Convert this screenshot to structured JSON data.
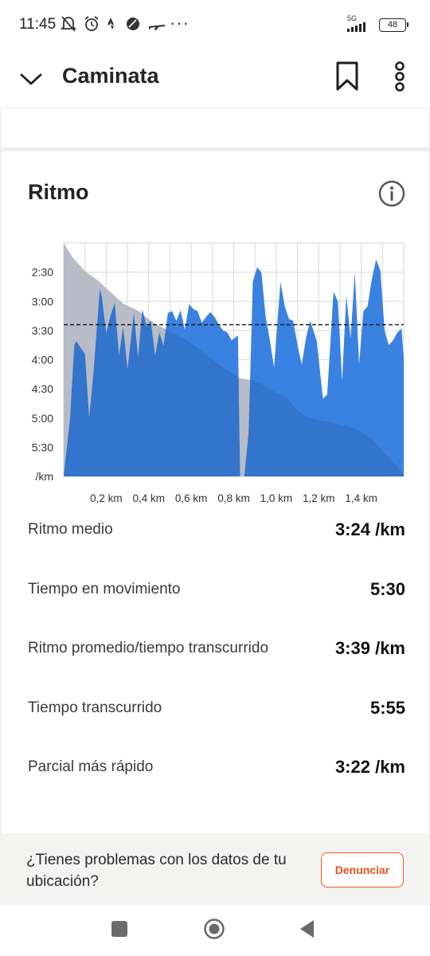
{
  "status_bar": {
    "time": "11:45",
    "network": "5G",
    "battery": "48",
    "icons": [
      "mute-icon",
      "alarm-icon",
      "strava-icon",
      "app-icon",
      "plane-icon",
      "more-dots-icon"
    ]
  },
  "header": {
    "title": "Caminata",
    "icons": [
      "chevron-down-icon",
      "bookmark-icon",
      "more-vertical-icon"
    ]
  },
  "section": {
    "title": "Ritmo",
    "info_icon": "info-icon"
  },
  "chart_data": {
    "type": "area",
    "y_unit_label": "/km",
    "y_ticks": [
      "2:30",
      "3:00",
      "3:30",
      "4:00",
      "4:30",
      "5:00",
      "5:30"
    ],
    "x_ticks": [
      "0,2 km",
      "0,4 km",
      "0,6 km",
      "0,8 km",
      "1,0 km",
      "1,2 km",
      "1,4 km"
    ],
    "y_range_seconds_per_km": [
      120,
      360
    ],
    "x_range_km": [
      0,
      1.6
    ],
    "average_pace_line_seconds": 204,
    "grid": true,
    "colors": {
      "pace": "#2f7be0",
      "elevation": "#d4d4d4",
      "average_line": "#111111"
    },
    "pace_series_seconds_per_km": [
      [
        0.0,
        360
      ],
      [
        0.03,
        300
      ],
      [
        0.05,
        225
      ],
      [
        0.06,
        221
      ],
      [
        0.08,
        228
      ],
      [
        0.1,
        234
      ],
      [
        0.12,
        300
      ],
      [
        0.14,
        253
      ],
      [
        0.17,
        167
      ],
      [
        0.18,
        176
      ],
      [
        0.2,
        213
      ],
      [
        0.22,
        195
      ],
      [
        0.24,
        181
      ],
      [
        0.26,
        236
      ],
      [
        0.28,
        206
      ],
      [
        0.3,
        250
      ],
      [
        0.33,
        192
      ],
      [
        0.35,
        238
      ],
      [
        0.37,
        188
      ],
      [
        0.39,
        206
      ],
      [
        0.41,
        200
      ],
      [
        0.43,
        236
      ],
      [
        0.45,
        212
      ],
      [
        0.47,
        226
      ],
      [
        0.49,
        192
      ],
      [
        0.51,
        190
      ],
      [
        0.53,
        200
      ],
      [
        0.55,
        189
      ],
      [
        0.57,
        209
      ],
      [
        0.59,
        183
      ],
      [
        0.61,
        188
      ],
      [
        0.63,
        190
      ],
      [
        0.65,
        202
      ],
      [
        0.67,
        196
      ],
      [
        0.69,
        191
      ],
      [
        0.71,
        196
      ],
      [
        0.73,
        204
      ],
      [
        0.75,
        210
      ],
      [
        0.77,
        212
      ],
      [
        0.79,
        220
      ],
      [
        0.82,
        215
      ],
      [
        0.83,
        360
      ],
      [
        0.85,
        360
      ],
      [
        0.87,
        315
      ],
      [
        0.89,
        160
      ],
      [
        0.91,
        145
      ],
      [
        0.93,
        150
      ],
      [
        0.95,
        195
      ],
      [
        0.97,
        220
      ],
      [
        0.99,
        248
      ],
      [
        1.02,
        160
      ],
      [
        1.04,
        185
      ],
      [
        1.06,
        198
      ],
      [
        1.08,
        200
      ],
      [
        1.1,
        225
      ],
      [
        1.12,
        245
      ],
      [
        1.14,
        218
      ],
      [
        1.16,
        200
      ],
      [
        1.19,
        220
      ],
      [
        1.22,
        280
      ],
      [
        1.24,
        276
      ],
      [
        1.27,
        170
      ],
      [
        1.29,
        180
      ],
      [
        1.31,
        262
      ],
      [
        1.33,
        174
      ],
      [
        1.35,
        218
      ],
      [
        1.37,
        150
      ],
      [
        1.39,
        245
      ],
      [
        1.41,
        190
      ],
      [
        1.43,
        185
      ],
      [
        1.45,
        157
      ],
      [
        1.47,
        137
      ],
      [
        1.49,
        148
      ],
      [
        1.51,
        210
      ],
      [
        1.53,
        225
      ],
      [
        1.55,
        220
      ],
      [
        1.57,
        212
      ],
      [
        1.59,
        208
      ],
      [
        1.6,
        240
      ]
    ],
    "elevation_series_relative": [
      [
        0.0,
        1.0
      ],
      [
        0.04,
        0.94
      ],
      [
        0.1,
        0.88
      ],
      [
        0.16,
        0.84
      ],
      [
        0.22,
        0.79
      ],
      [
        0.28,
        0.74
      ],
      [
        0.35,
        0.71
      ],
      [
        0.42,
        0.66
      ],
      [
        0.5,
        0.62
      ],
      [
        0.57,
        0.59
      ],
      [
        0.63,
        0.55
      ],
      [
        0.7,
        0.5
      ],
      [
        0.76,
        0.46
      ],
      [
        0.83,
        0.42
      ],
      [
        0.9,
        0.41
      ],
      [
        0.96,
        0.38
      ],
      [
        1.0,
        0.36
      ],
      [
        1.05,
        0.34
      ],
      [
        1.1,
        0.28
      ],
      [
        1.16,
        0.25
      ],
      [
        1.21,
        0.24
      ],
      [
        1.27,
        0.23
      ],
      [
        1.31,
        0.22
      ],
      [
        1.36,
        0.21
      ],
      [
        1.4,
        0.19
      ],
      [
        1.45,
        0.16
      ],
      [
        1.5,
        0.11
      ],
      [
        1.55,
        0.06
      ],
      [
        1.59,
        0.02
      ],
      [
        1.6,
        0.0
      ]
    ]
  },
  "stats": [
    {
      "label": "Ritmo medio",
      "value": "3:24 /km"
    },
    {
      "label": "Tiempo en movimiento",
      "value": "5:30"
    },
    {
      "label": "Ritmo promedio/tiempo transcurrido",
      "value": "3:39 /km"
    },
    {
      "label": "Tiempo transcurrido",
      "value": "5:55"
    },
    {
      "label": "Parcial más rápido",
      "value": "3:22 /km"
    }
  ],
  "report": {
    "text": "¿Tienes problemas con los datos de tu ubicación?",
    "button_label": "Denunciar"
  },
  "nav_bar": {
    "icons": [
      "recents-icon",
      "home-icon",
      "back-icon"
    ]
  }
}
